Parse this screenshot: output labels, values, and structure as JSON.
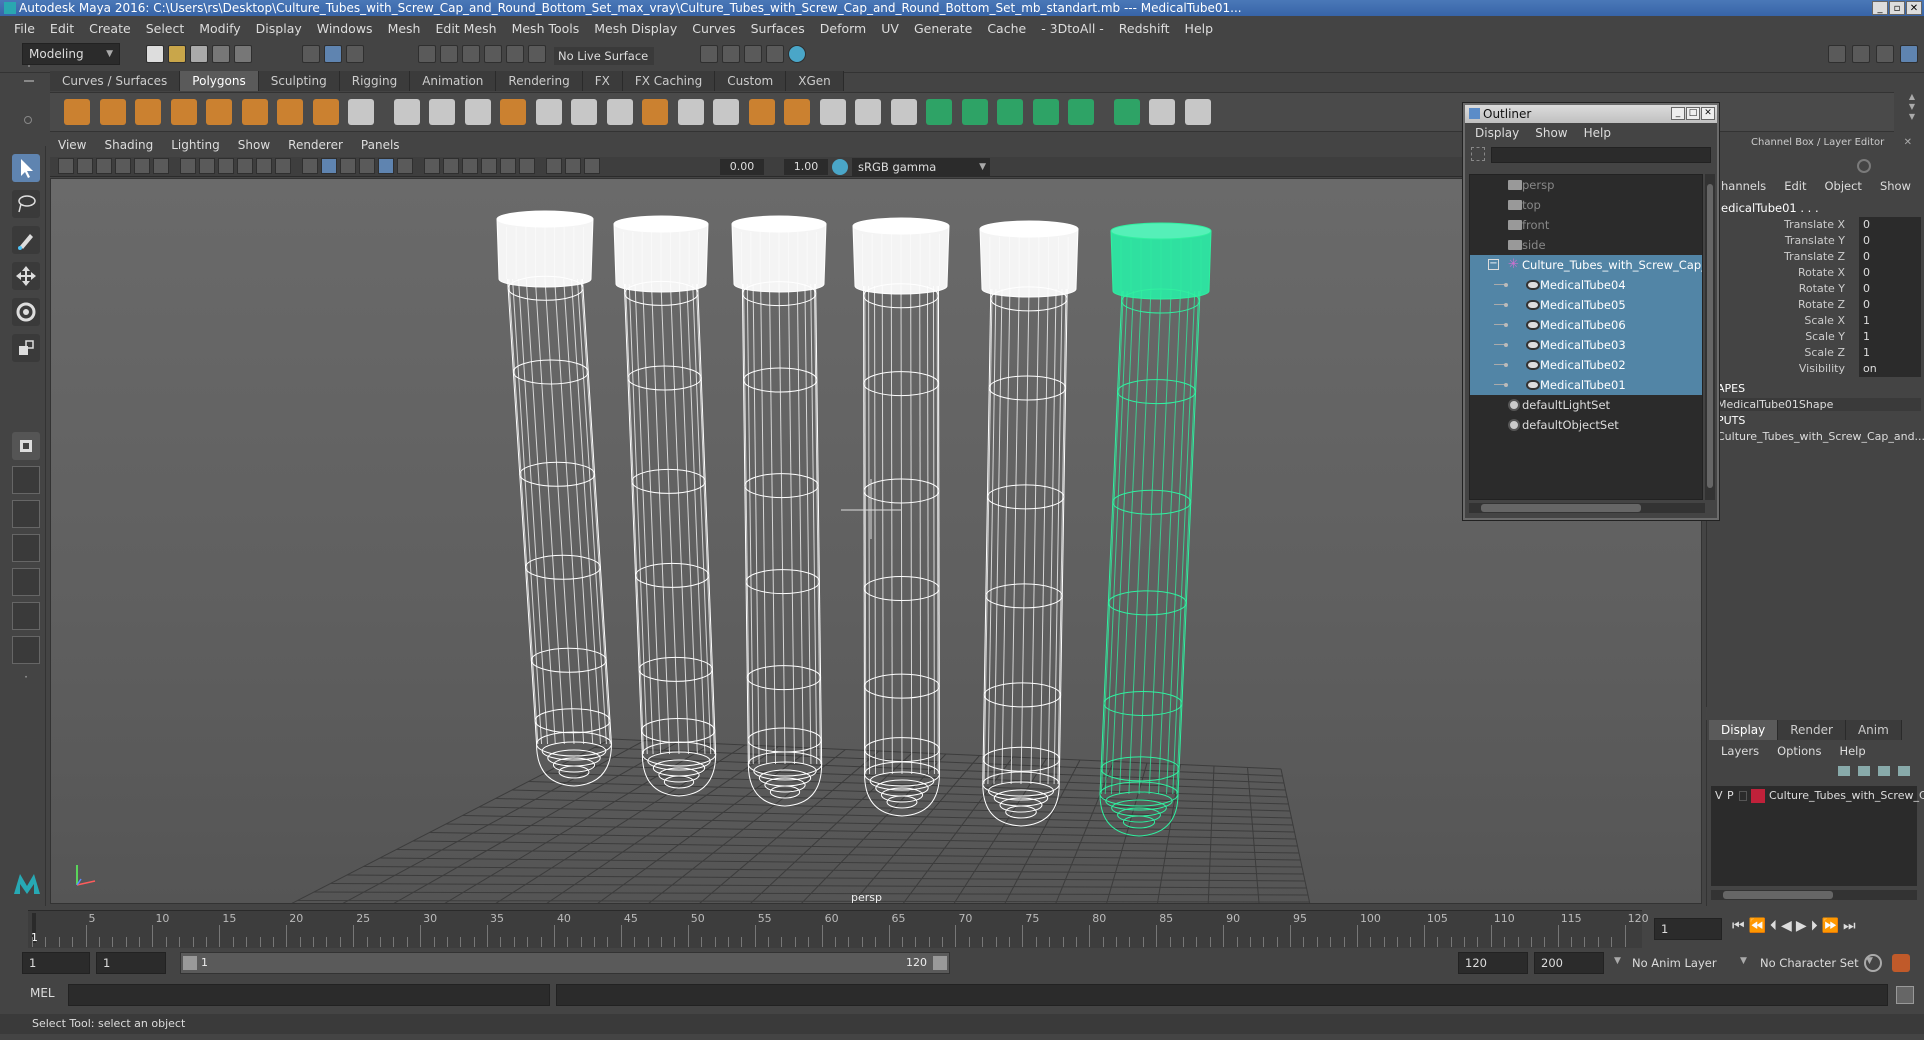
{
  "window": {
    "title": "Autodesk Maya 2016: C:\\Users\\rs\\Desktop\\Culture_Tubes_with_Screw_Cap_and_Round_Bottom_Set_max_vray\\Culture_Tubes_with_Screw_Cap_and_Round_Bottom_Set_mb_standart.mb  ---  MedicalTube01...",
    "btn_min": "_",
    "btn_restore": "▫",
    "btn_close": "✕"
  },
  "menubar": [
    "File",
    "Edit",
    "Create",
    "Select",
    "Modify",
    "Display",
    "Windows",
    "Mesh",
    "Edit Mesh",
    "Mesh Tools",
    "Mesh Display",
    "Curves",
    "Surfaces",
    "Deform",
    "UV",
    "Generate",
    "Cache",
    "- 3DtoAll -",
    "Redshift",
    "Help"
  ],
  "status": {
    "mode": "Modeling",
    "live_surface": "No Live Surface"
  },
  "shelf_tabs": [
    {
      "label": "Curves / Surfaces",
      "active": false
    },
    {
      "label": "Polygons",
      "active": true
    },
    {
      "label": "Sculpting",
      "active": false
    },
    {
      "label": "Rigging",
      "active": false
    },
    {
      "label": "Animation",
      "active": false
    },
    {
      "label": "Rendering",
      "active": false
    },
    {
      "label": "FX",
      "active": false
    },
    {
      "label": "FX Caching",
      "active": false
    },
    {
      "label": "Custom",
      "active": false
    },
    {
      "label": "XGen",
      "active": false
    }
  ],
  "panel_menu": [
    "View",
    "Shading",
    "Lighting",
    "Show",
    "Renderer",
    "Panels"
  ],
  "panel_toolbar": {
    "exposure": "0.00",
    "gamma": "1.00",
    "color_space": "sRGB gamma"
  },
  "viewport": {
    "camera_label": "persp"
  },
  "outliner": {
    "title": "Outliner",
    "menu": [
      "Display",
      "Show",
      "Help"
    ],
    "items": [
      {
        "label": "persp",
        "indent": 0,
        "kind": "camera",
        "dim": true,
        "selected": false
      },
      {
        "label": "top",
        "indent": 0,
        "kind": "camera",
        "dim": true,
        "selected": false
      },
      {
        "label": "front",
        "indent": 0,
        "kind": "camera",
        "dim": true,
        "selected": false
      },
      {
        "label": "side",
        "indent": 0,
        "kind": "camera",
        "dim": true,
        "selected": false
      },
      {
        "label": "Culture_Tubes_with_Screw_Cap_a",
        "indent": 0,
        "kind": "group",
        "dim": false,
        "selected": true
      },
      {
        "label": "MedicalTube04",
        "indent": 1,
        "kind": "mesh",
        "dim": false,
        "selected": true
      },
      {
        "label": "MedicalTube05",
        "indent": 1,
        "kind": "mesh",
        "dim": false,
        "selected": true
      },
      {
        "label": "MedicalTube06",
        "indent": 1,
        "kind": "mesh",
        "dim": false,
        "selected": true
      },
      {
        "label": "MedicalTube03",
        "indent": 1,
        "kind": "mesh",
        "dim": false,
        "selected": true
      },
      {
        "label": "MedicalTube02",
        "indent": 1,
        "kind": "mesh",
        "dim": false,
        "selected": true
      },
      {
        "label": "MedicalTube01",
        "indent": 1,
        "kind": "mesh",
        "dim": false,
        "selected": true
      },
      {
        "label": "defaultLightSet",
        "indent": 0,
        "kind": "set",
        "dim": false,
        "selected": false
      },
      {
        "label": "defaultObjectSet",
        "indent": 0,
        "kind": "set",
        "dim": false,
        "selected": false
      }
    ]
  },
  "channel_box": {
    "header": "Channel Box / Layer Editor",
    "menu": [
      "hannels",
      "Edit",
      "Object",
      "Show"
    ],
    "object_name": "edicalTube01 . . .",
    "channels": [
      {
        "label": "Translate X",
        "value": "0"
      },
      {
        "label": "Translate Y",
        "value": "0"
      },
      {
        "label": "Translate Z",
        "value": "0"
      },
      {
        "label": "Rotate X",
        "value": "0"
      },
      {
        "label": "Rotate Y",
        "value": "0"
      },
      {
        "label": "Rotate Z",
        "value": "0"
      },
      {
        "label": "Scale X",
        "value": "1"
      },
      {
        "label": "Scale Y",
        "value": "1"
      },
      {
        "label": "Scale Z",
        "value": "1"
      },
      {
        "label": "Visibility",
        "value": "on"
      }
    ],
    "shapes_header": "APES",
    "shape_name": "MedicalTube01Shape",
    "inputs_header": "PUTS",
    "input_name": "Culture_Tubes_with_Screw_Cap_and..."
  },
  "layer_editor": {
    "tabs": [
      "Display",
      "Render",
      "Anim"
    ],
    "menu": [
      "Layers",
      "Options",
      "Help"
    ],
    "layer": {
      "v": "V",
      "p": "P",
      "name": "Culture_Tubes_with_Screw_C",
      "color": "#c0213a"
    }
  },
  "timeline": {
    "ticks": [
      "5",
      "10",
      "15",
      "20",
      "25",
      "30",
      "35",
      "40",
      "45",
      "50",
      "55",
      "60",
      "65",
      "70",
      "75",
      "80",
      "85",
      "90",
      "95",
      "100",
      "105",
      "110",
      "115",
      "120"
    ],
    "current_frame_marker": "1",
    "current_frame": "1"
  },
  "range": {
    "start": "1",
    "playback_start": "1",
    "slider_start": "1",
    "slider_end": "120",
    "playback_end": "120",
    "end": "200",
    "anim_layer": "No Anim Layer",
    "character_set": "No Character Set"
  },
  "command": {
    "lang": "MEL"
  },
  "help_line": "Select Tool: select an object",
  "colors": {
    "selection": "#5285a6",
    "wire_selected": "#30f0a0",
    "wire": "#ffffff"
  }
}
